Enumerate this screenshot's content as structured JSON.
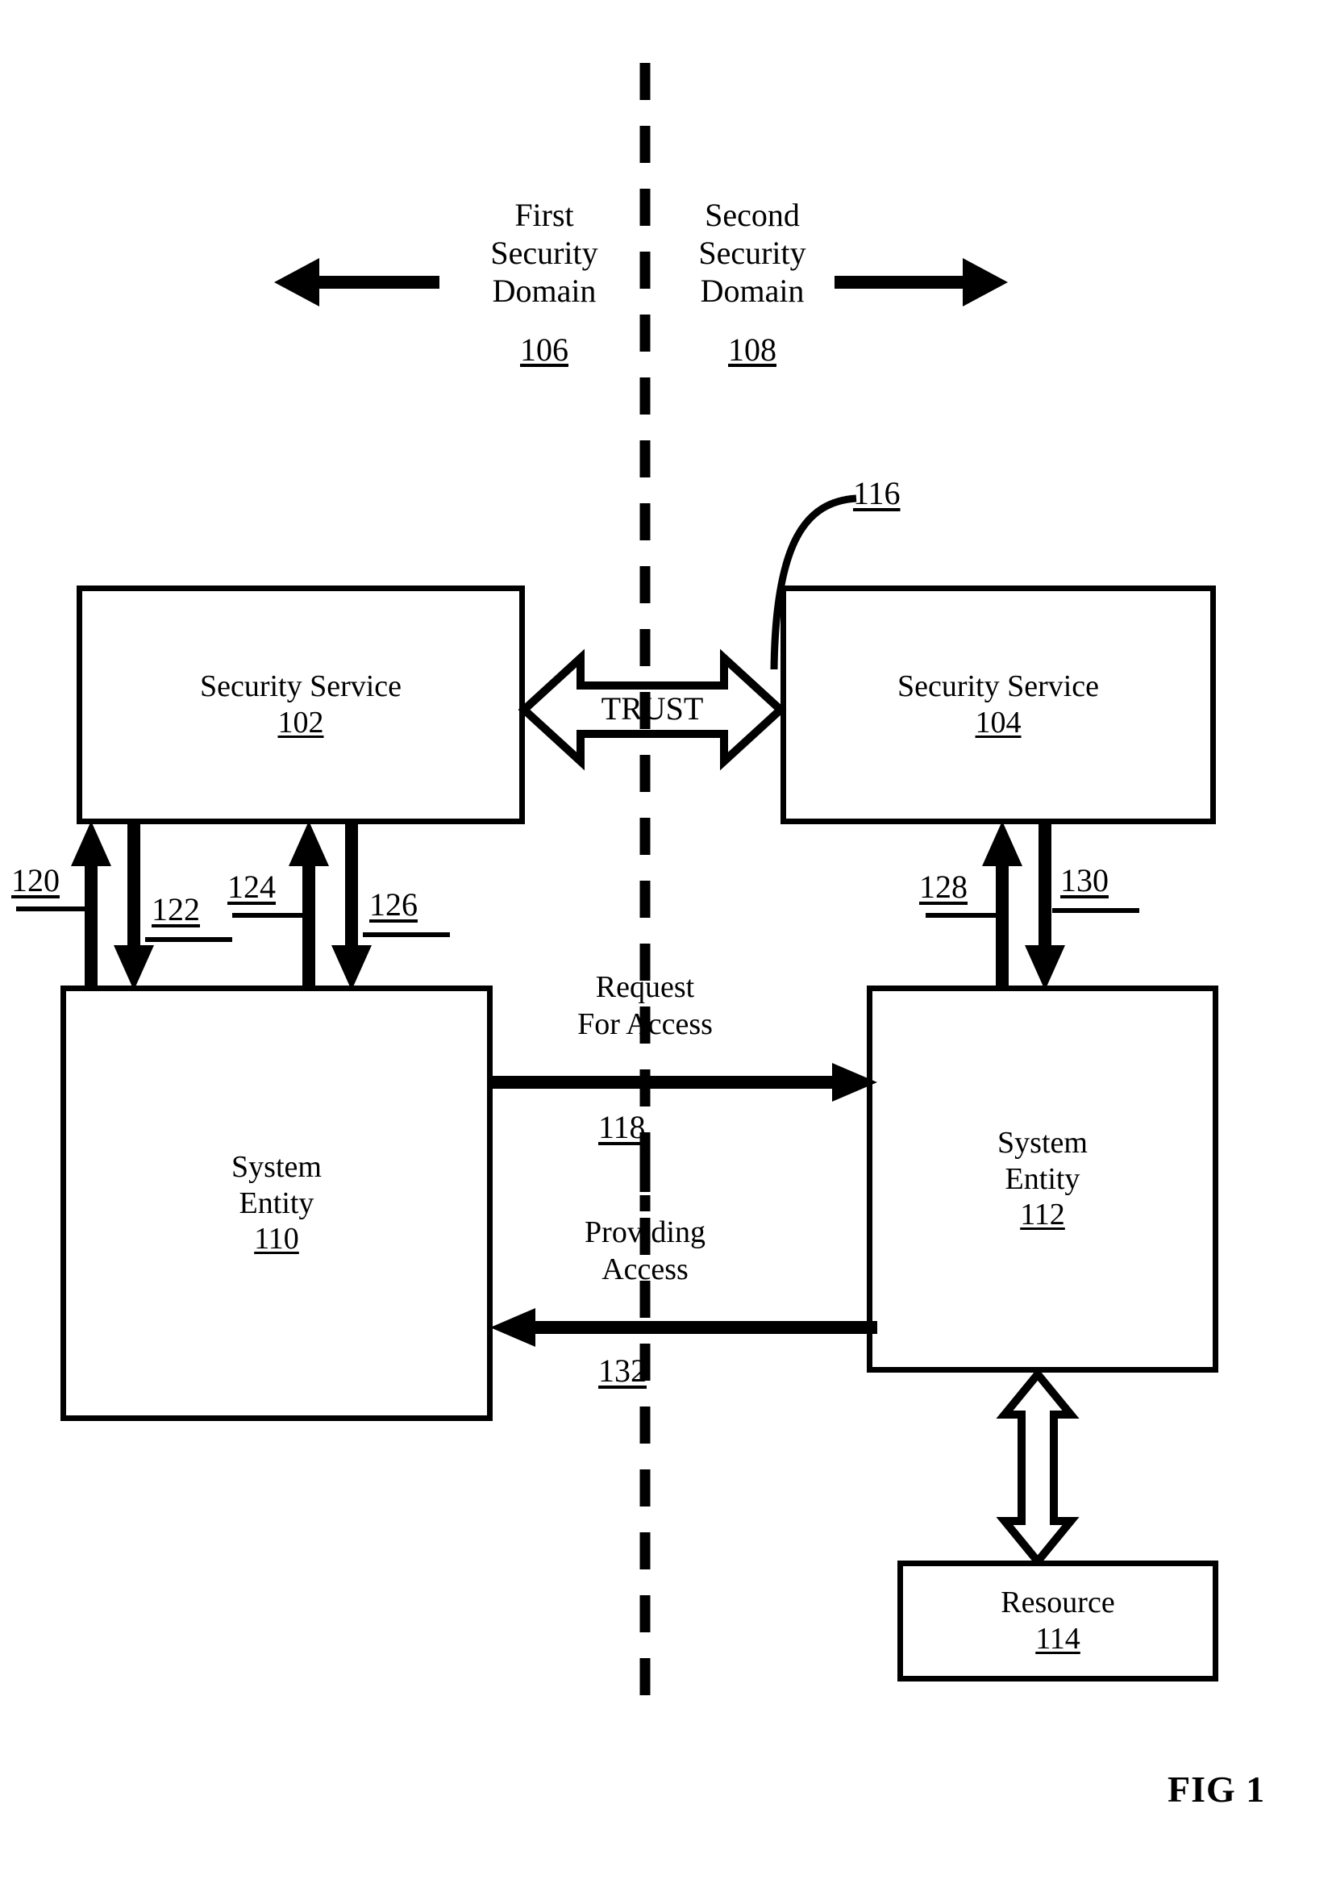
{
  "figure": {
    "label": "FIG 1",
    "domains": {
      "left": {
        "name": "First\nSecurity\nDomain",
        "ref": "106",
        "arrow": "left-arrow-icon"
      },
      "right": {
        "name": "Second\nSecurity\nDomain",
        "ref": "108",
        "arrow": "right-arrow-icon"
      }
    },
    "divider": "dashed-vertical-boundary-line",
    "boxes": [
      {
        "id": "security-service-102",
        "title": "Security Service",
        "ref": "102"
      },
      {
        "id": "security-service-104",
        "title": "Security Service",
        "ref": "104"
      },
      {
        "id": "system-entity-110",
        "title": "System\nEntity",
        "ref": "110"
      },
      {
        "id": "system-entity-112",
        "title": "System\nEntity",
        "ref": "112"
      },
      {
        "id": "resource-114",
        "title": "Resource",
        "ref": "114"
      }
    ],
    "trust": {
      "label": "TRUST",
      "ref": "116"
    },
    "flows": [
      {
        "id": "flow-118",
        "caption": "Request\nFor Access",
        "ref": "118",
        "direction": "right"
      },
      {
        "id": "flow-132",
        "caption": "Providing\nAccess",
        "ref": "132",
        "direction": "left"
      }
    ],
    "connectors": [
      {
        "ref": "120",
        "direction": "up"
      },
      {
        "ref": "122",
        "direction": "down"
      },
      {
        "ref": "124",
        "direction": "up"
      },
      {
        "ref": "126",
        "direction": "down"
      },
      {
        "ref": "128",
        "direction": "up"
      },
      {
        "ref": "130",
        "direction": "down"
      }
    ]
  }
}
